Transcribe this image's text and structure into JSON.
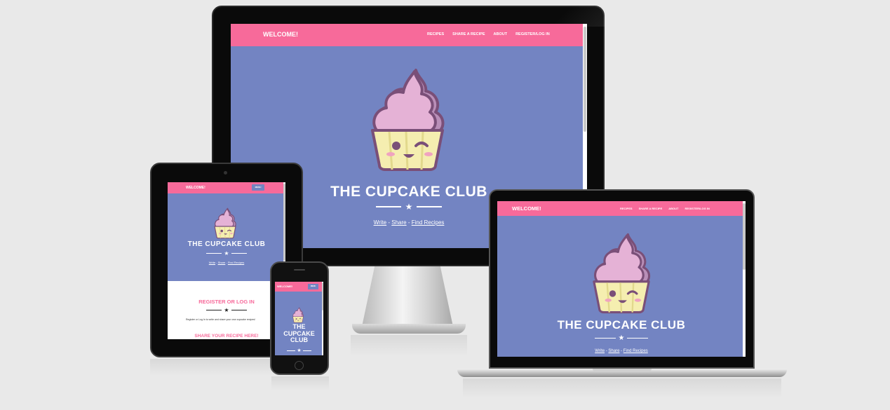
{
  "site": {
    "brand": "WELCOME!",
    "nav": [
      "RECIPES",
      "SHARE A RECIPE",
      "ABOUT",
      "REGISTER/LOG IN"
    ],
    "title": "THE CUPCAKE CLUB",
    "title_line1": "THE",
    "title_line2": "CUPCAKE",
    "title_line3": "CLUB",
    "tagline": {
      "write": "Write",
      "share": "Share",
      "find": "Find Recipes",
      "sep": " - "
    },
    "register_heading": "REGISTER OR LOG IN",
    "register_text": "Register or Log In to write and share your own cupcake recipes!",
    "register_link": "Register or Log In",
    "share_heading": "SHARE YOUR RECIPE HERE!",
    "menu_button": "MENU"
  },
  "colors": {
    "pink": "#f76a9a",
    "hero": "#7384c2",
    "frosting": "#e5b2d6",
    "cake": "#f5eeb0"
  }
}
